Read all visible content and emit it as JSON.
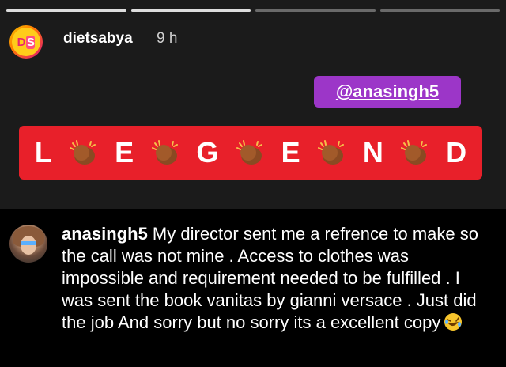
{
  "story": {
    "username": "dietsabya",
    "time": "9 h",
    "avatar_text_1": "D",
    "avatar_text_2": "S",
    "mention": "@anasingh5",
    "banner_letters": [
      "L",
      "E",
      "G",
      "E",
      "N",
      "D"
    ],
    "banner_color": "#e8202a",
    "mention_color": "#9c36c8",
    "progress_segments": 4,
    "progress_active_index": 1
  },
  "comment": {
    "username": "anasingh5",
    "text": " My director sent me a refrence to make so the call was not mine . Access to clothes was impossible and requirement needed to be fulfilled . I was sent the book vanitas by gianni versace . Just did the job And sorry but no sorry its a excellent copy",
    "emoji": "rolling-on-floor-laughing-icon"
  }
}
